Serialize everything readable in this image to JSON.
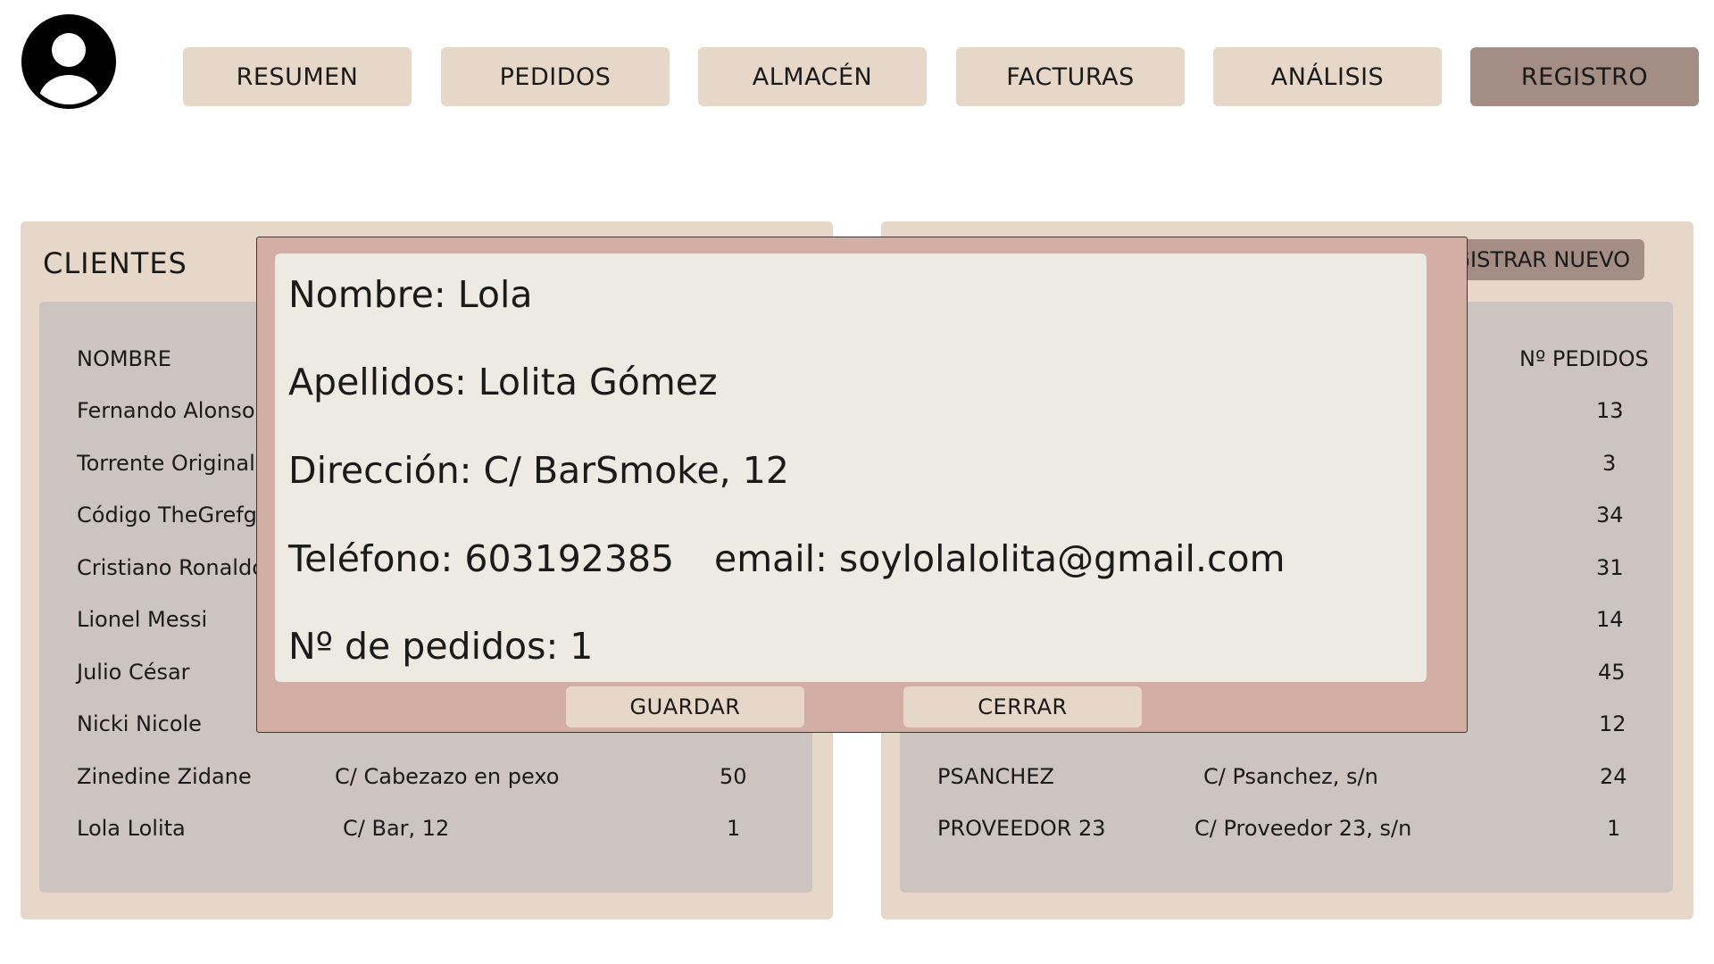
{
  "nav": [
    {
      "label": "RESUMEN"
    },
    {
      "label": "PEDIDOS"
    },
    {
      "label": "ALMACÉN"
    },
    {
      "label": "FACTURAS"
    },
    {
      "label": "ANÁLISIS"
    },
    {
      "label": "REGISTRO"
    }
  ],
  "nav_active": "REGISTRO",
  "avatar_icon": "user-avatar-icon",
  "clients": {
    "title": "CLIENTES",
    "header_name": "NOMBRE",
    "rows": [
      {
        "name": "Fernando Alonso"
      },
      {
        "name": "Torrente Original"
      },
      {
        "name": "Código TheGrefg"
      },
      {
        "name": "Cristiano Ronaldo"
      },
      {
        "name": "Lionel Messi"
      },
      {
        "name": "Julio César"
      },
      {
        "name": "Nicki Nicole"
      },
      {
        "name": "Zinedine Zidane",
        "address": "C/ Cabezazo en pexo",
        "orders": "50"
      },
      {
        "name": "Lola Lolita",
        "address": "C/ Bar, 12",
        "orders": "1"
      }
    ]
  },
  "suppliers": {
    "register_label": "GISTRAR NUEVO",
    "header_orders": "Nº PEDIDOS",
    "rows": [
      {
        "orders": "13"
      },
      {
        "orders": "3"
      },
      {
        "orders": "34"
      },
      {
        "orders": "31"
      },
      {
        "orders": "14"
      },
      {
        "orders": "45"
      },
      {
        "orders": "12"
      },
      {
        "name": "PSANCHEZ",
        "address": "C/ Psanchez, s/n",
        "orders": "24"
      },
      {
        "name": "PROVEEDOR 23",
        "address": "C/ Proveedor 23, s/n",
        "orders": "1"
      }
    ]
  },
  "modal": {
    "nombre": "Nombre: Lola",
    "apellidos": "Apellidos: Lolita Gómez",
    "direccion": "Dirección: C/ BarSmoke, 12",
    "telefono": "Teléfono: 603192385",
    "email": "email: soylolalolita@gmail.com",
    "pedidos": "Nº de pedidos: 1",
    "save_label": "GUARDAR",
    "close_label": "CERRAR"
  },
  "colors": {
    "nav_bg": "#e6d7c8",
    "nav_active_bg": "#a38d84",
    "panel_bg": "#e6d7c8",
    "table_bg": "#cdc4c1",
    "modal_bg": "#d2aea5",
    "modal_inner_bg": "#ede9e3"
  }
}
